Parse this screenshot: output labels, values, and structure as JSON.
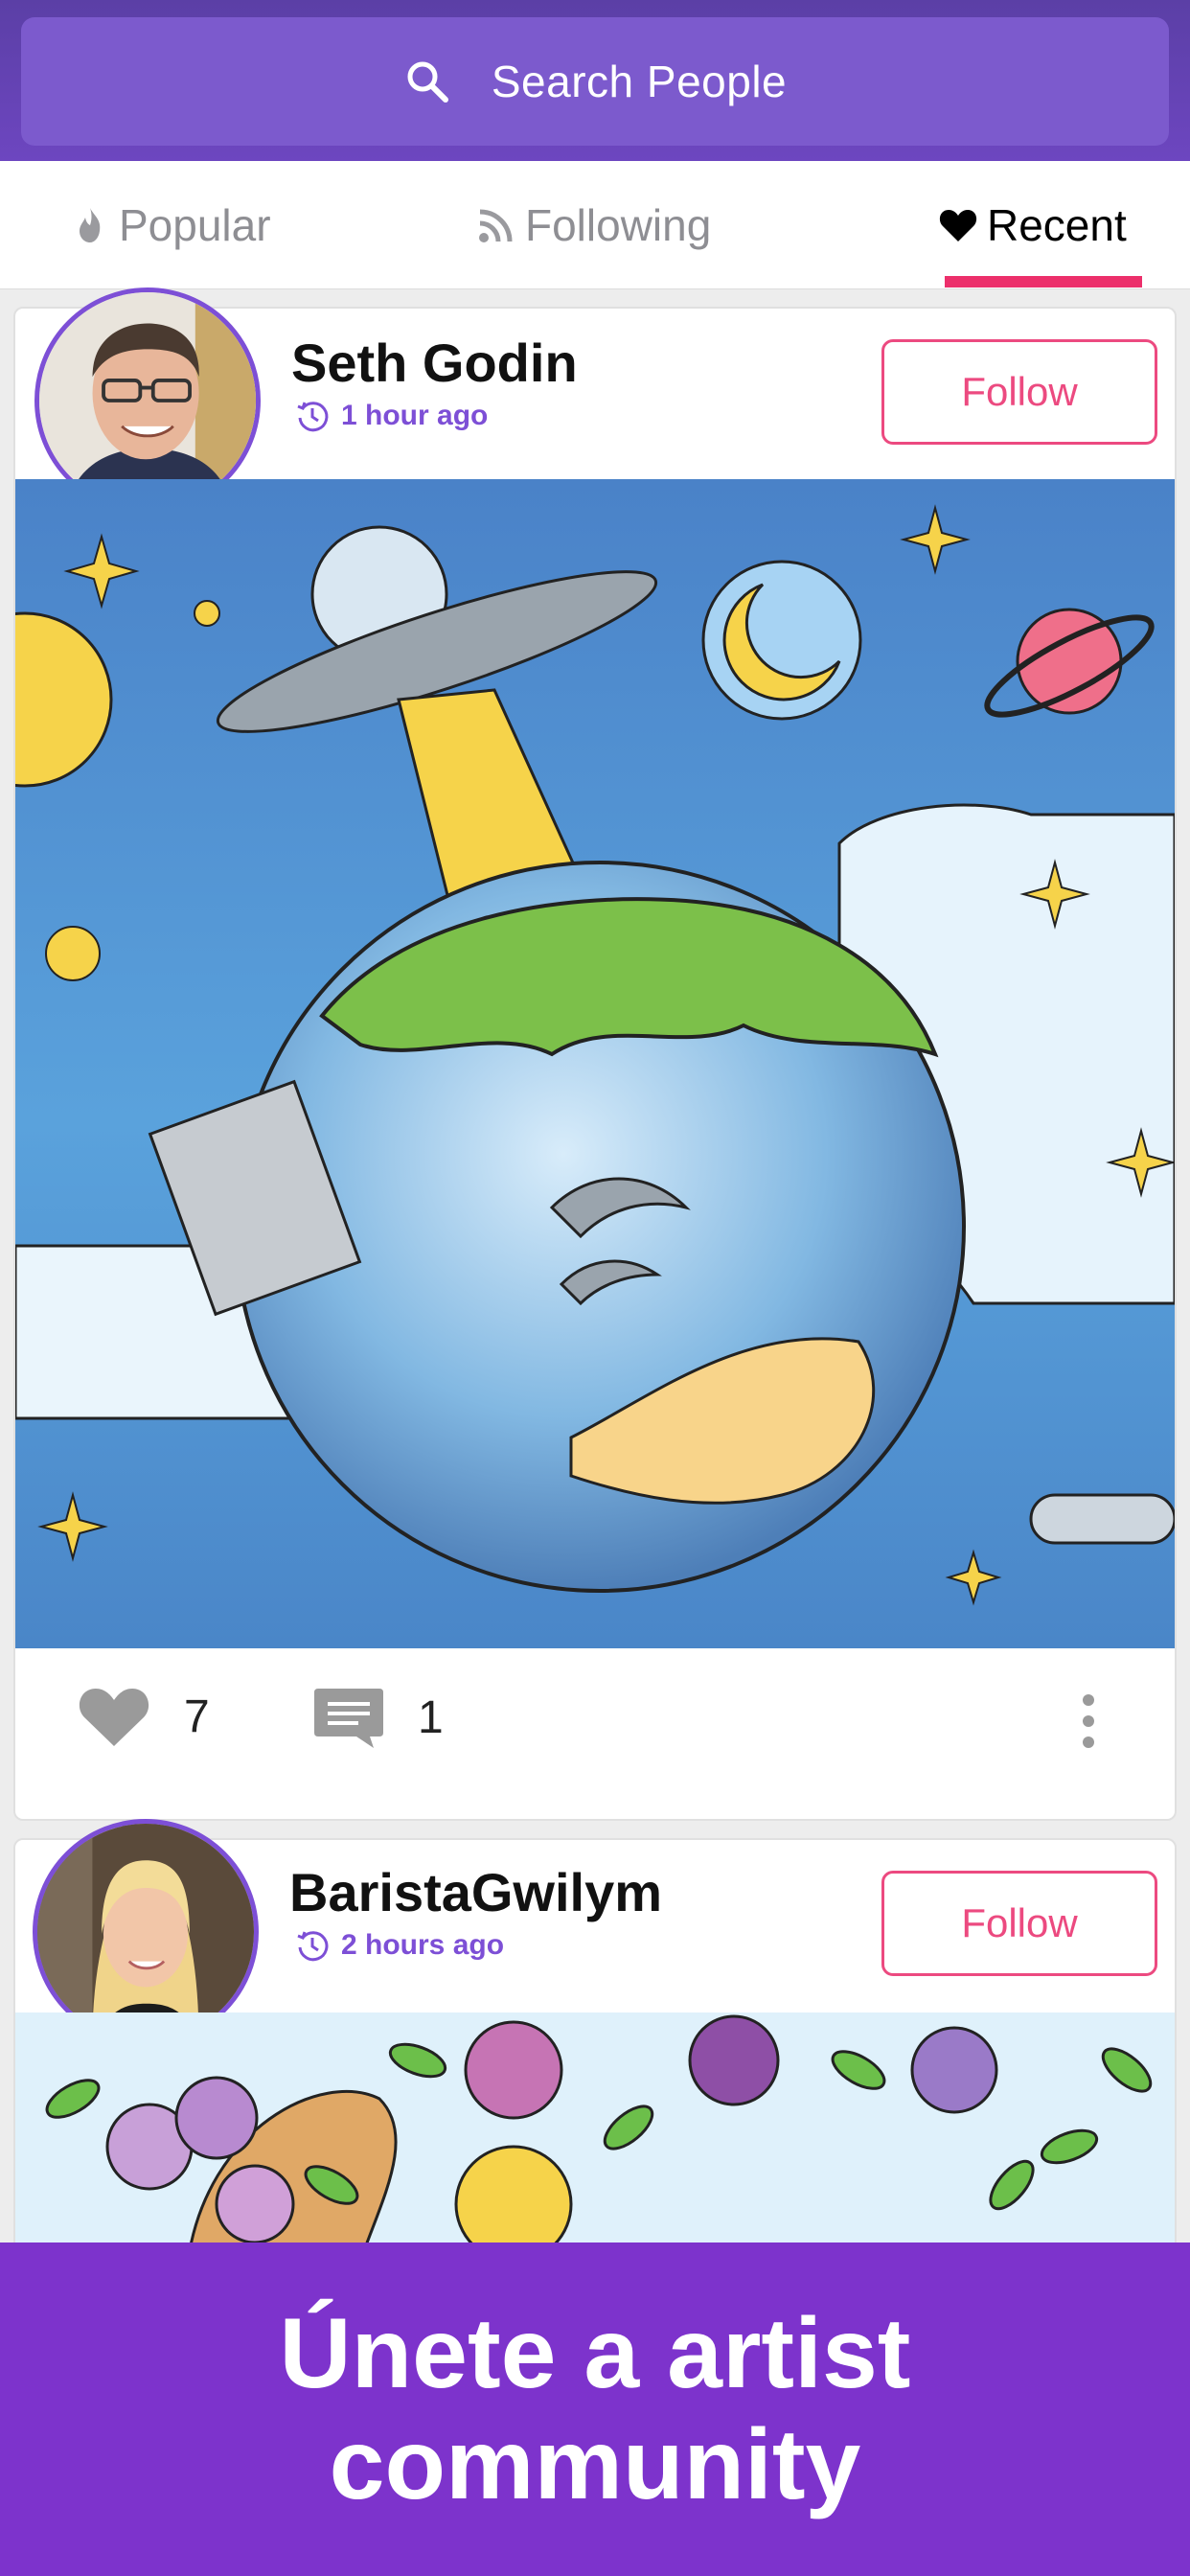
{
  "search": {
    "label": "Search People"
  },
  "tabs": [
    {
      "label": "Popular",
      "icon": "flame-icon",
      "active": false
    },
    {
      "label": "Following",
      "icon": "rss-icon",
      "active": false
    },
    {
      "label": "Recent",
      "icon": "heart-icon",
      "active": true
    }
  ],
  "posts": [
    {
      "username": "Seth Godin",
      "time": "1 hour ago",
      "follow_label": "Follow",
      "likes": "7",
      "comments": "1"
    },
    {
      "username": "BaristaGwilym",
      "time": "2 hours ago",
      "follow_label": "Follow"
    }
  ],
  "promo": {
    "text": "Únete a artist community"
  },
  "colors": {
    "header": "#6a46bf",
    "accent_purple": "#7d4fd6",
    "follow_pink": "#ec4a80",
    "tab_underline": "#ec2f6b",
    "promo_bg": "#7d33cc"
  }
}
